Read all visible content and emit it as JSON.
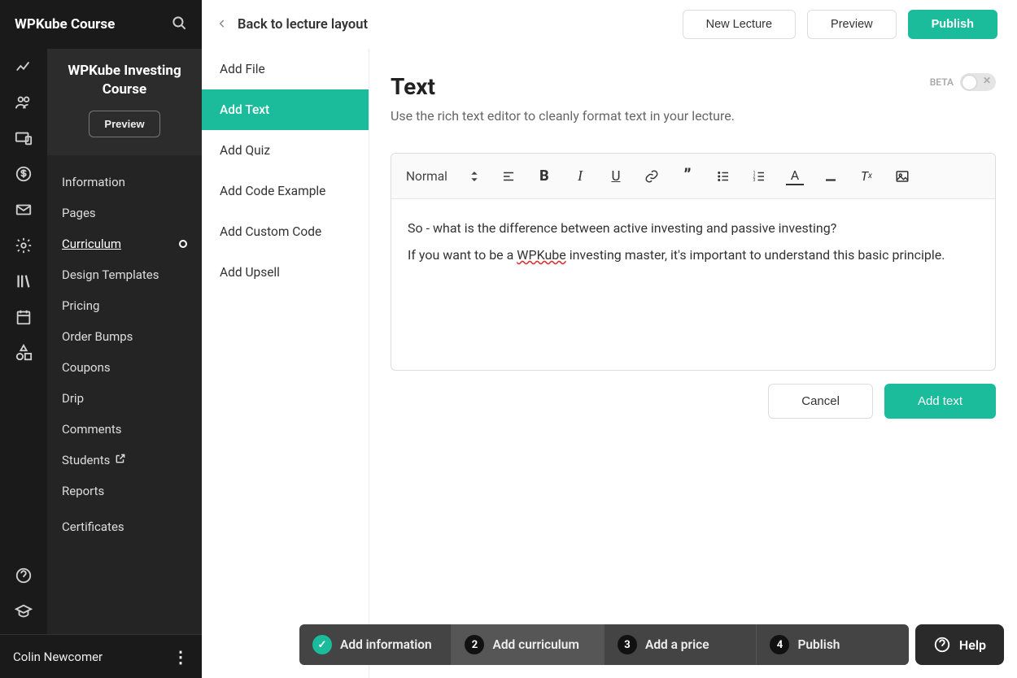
{
  "header": {
    "brand": "WPKube Course"
  },
  "course": {
    "title": "WPKube Investing Course",
    "preview_btn": "Preview"
  },
  "nav": {
    "items": [
      {
        "label": "Information"
      },
      {
        "label": "Pages"
      },
      {
        "label": "Curriculum",
        "active": true
      },
      {
        "label": "Design Templates"
      },
      {
        "label": "Pricing"
      },
      {
        "label": "Order Bumps"
      },
      {
        "label": "Coupons"
      },
      {
        "label": "Drip"
      },
      {
        "label": "Comments"
      },
      {
        "label": "Students",
        "external": true
      },
      {
        "label": "Reports"
      },
      {
        "label": "Certificates"
      }
    ]
  },
  "user": {
    "name": "Colin Newcomer"
  },
  "add_panel": {
    "items": [
      {
        "label": "Add File"
      },
      {
        "label": "Add Text",
        "active": true
      },
      {
        "label": "Add Quiz"
      },
      {
        "label": "Add Code Example"
      },
      {
        "label": "Add Custom Code"
      },
      {
        "label": "Add Upsell"
      }
    ]
  },
  "topbar": {
    "back": "Back to lecture layout",
    "new_lecture": "New Lecture",
    "preview": "Preview",
    "publish": "Publish"
  },
  "content": {
    "heading": "Text",
    "subtitle": "Use the rich text editor to cleanly format text in your lecture.",
    "beta": "BETA",
    "toolbar_style": "Normal",
    "body_p1": "So - what is the difference between active investing and passive investing?",
    "body_p2a": "If you want to be a ",
    "body_p2_err": "WPKube",
    "body_p2b": " investing master, it's important to understand this basic principle.",
    "cancel": "Cancel",
    "add_text": "Add text"
  },
  "steps": {
    "s1": "Add information",
    "s2": "Add curriculum",
    "s3": "Add a price",
    "s4": "Publish",
    "help": "Help"
  }
}
